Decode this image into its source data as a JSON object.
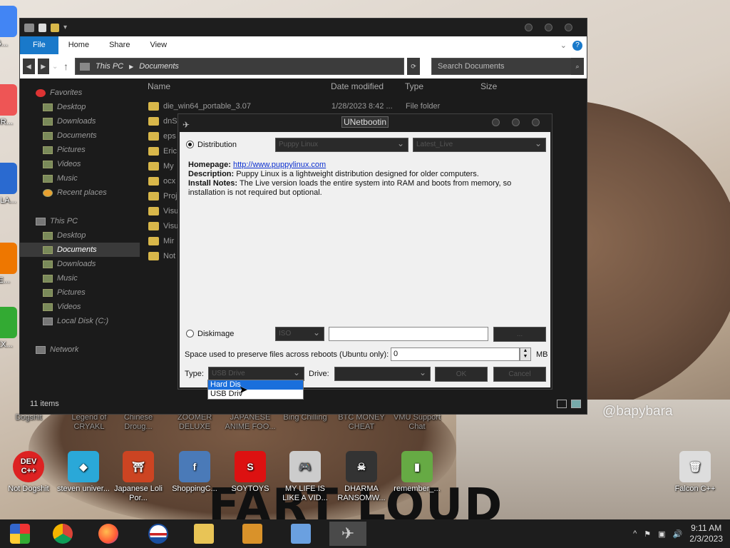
{
  "desktop": {
    "watermark": "@bapybara",
    "caption": "FART LOUD",
    "row_icons": [
      {
        "label": "Dogshit",
        "color": "#c33"
      },
      {
        "label": "Legend of CRYAKL",
        "color": "#555"
      },
      {
        "label": "Chinese Droug...",
        "color": "#8a4"
      },
      {
        "label": "ZOOMER DELUXE",
        "color": "#c63"
      },
      {
        "label": "JAPANESE ANIME FOO...",
        "color": "#a35"
      },
      {
        "label": "Bing Chilling",
        "color": "#58a"
      },
      {
        "label": "BTC MONEY CHEAT",
        "color": "#d90"
      },
      {
        "label": "VMU Support Chat",
        "color": "#469"
      }
    ],
    "bottom_icons": [
      {
        "label": "Not Dogshit",
        "color": "#d22",
        "glyph": "DEV C++"
      },
      {
        "label": "steven univer...",
        "color": "#2aa8d8",
        "glyph": "◆"
      },
      {
        "label": "Japanese Loli Por...",
        "color": "#c42",
        "glyph": "⛩"
      },
      {
        "label": "ShoppingC...",
        "color": "#4a7ab8",
        "glyph": "f"
      },
      {
        "label": "SOYTOYS",
        "color": "#d11",
        "glyph": "S"
      },
      {
        "label": "MY LIFE IS LIKE A VID...",
        "color": "#ccc",
        "glyph": "🎮"
      },
      {
        "label": "DHARMA RANSOMW...",
        "color": "#333",
        "glyph": "☠"
      },
      {
        "label": "remember_...",
        "color": "#6a4",
        "glyph": "▮"
      },
      {
        "label": "Falcon C++",
        "color": "#ddd",
        "glyph": "🗑"
      }
    ],
    "left_icons": [
      {
        "label": "G..."
      },
      {
        "label": "FUR..."
      },
      {
        "label": "OS LA..."
      },
      {
        "label": "BE..."
      },
      {
        "label": "SEX..."
      }
    ]
  },
  "explorer": {
    "ribbon_tabs": [
      "File",
      "Home",
      "Share",
      "View"
    ],
    "address": [
      "This PC",
      "Documents"
    ],
    "search_placeholder": "Search Documents",
    "nav": [
      {
        "label": "Favorites",
        "type": "hdr",
        "icon": "heart-icon"
      },
      {
        "label": "Desktop",
        "type": "item",
        "icon": "folder-icon"
      },
      {
        "label": "Downloads",
        "type": "item",
        "icon": "folder-icon"
      },
      {
        "label": "Documents",
        "type": "item",
        "icon": "folder-icon"
      },
      {
        "label": "Pictures",
        "type": "item",
        "icon": "folder-icon"
      },
      {
        "label": "Videos",
        "type": "item",
        "icon": "folder-icon"
      },
      {
        "label": "Music",
        "type": "item",
        "icon": "folder-icon"
      },
      {
        "label": "Recent places",
        "type": "item",
        "icon": "clock-icon"
      },
      {
        "label": "",
        "type": "spacer"
      },
      {
        "label": "This PC",
        "type": "hdr",
        "icon": "computer-icon"
      },
      {
        "label": "Desktop",
        "type": "item",
        "icon": "folder-icon"
      },
      {
        "label": "Documents",
        "type": "sel",
        "icon": "folder-icon"
      },
      {
        "label": "Downloads",
        "type": "item",
        "icon": "folder-icon"
      },
      {
        "label": "Music",
        "type": "item",
        "icon": "folder-icon"
      },
      {
        "label": "Pictures",
        "type": "item",
        "icon": "folder-icon"
      },
      {
        "label": "Videos",
        "type": "item",
        "icon": "folder-icon"
      },
      {
        "label": "Local Disk (C:)",
        "type": "item",
        "icon": "drive-icon"
      },
      {
        "label": "",
        "type": "spacer"
      },
      {
        "label": "Network",
        "type": "hdr",
        "icon": "network-icon"
      }
    ],
    "columns": [
      "Name",
      "Date modified",
      "Type",
      "Size"
    ],
    "files": [
      {
        "name": "die_win64_portable_3.07",
        "date": "1/28/2023 8:42 ...",
        "type": "File folder"
      },
      {
        "name": "dnS",
        "date": "",
        "type": ""
      },
      {
        "name": "eps",
        "date": "",
        "type": ""
      },
      {
        "name": "Eric",
        "date": "",
        "type": ""
      },
      {
        "name": "My",
        "date": "",
        "type": ""
      },
      {
        "name": "ocx",
        "date": "",
        "type": ""
      },
      {
        "name": "Proj",
        "date": "",
        "type": ""
      },
      {
        "name": "Visu",
        "date": "",
        "type": ""
      },
      {
        "name": "Visu",
        "date": "",
        "type": ""
      },
      {
        "name": "Mir",
        "date": "",
        "type": ""
      },
      {
        "name": "Not",
        "date": "",
        "type": ""
      }
    ],
    "status": "11 items"
  },
  "unetbootin": {
    "title": "UNetbootin",
    "distribution_label": "Distribution",
    "distribution_value": "Puppy Linux",
    "version_value": "Latest_Live",
    "homepage_label": "Homepage:",
    "homepage_url": "http://www.puppylinux.com",
    "description_label": "Description:",
    "description": "Puppy Linux is a lightweight distribution designed for older computers.",
    "install_label": "Install Notes:",
    "install_notes": "The Live version loads the entire system into RAM and boots from memory, so installation is not required but optional.",
    "diskimage_label": "Diskimage",
    "diskimage_type": "ISO",
    "diskimage_path": "",
    "browse_label": "...",
    "persist_label": "Space used to preserve files across reboots (Ubuntu only):",
    "persist_value": "0",
    "persist_unit": "MB",
    "type_label": "Type:",
    "type_value": "USB Drive",
    "drive_label": "Drive:",
    "drive_value": "",
    "ok_label": "OK",
    "cancel_label": "Cancel",
    "type_options": [
      "Hard Disk",
      "USB Drive"
    ],
    "type_options_display": [
      "Hard Dis",
      "USB Driv"
    ]
  },
  "taskbar": {
    "time": "9:11 AM",
    "date": "2/3/2023",
    "apps": [
      "start-button",
      "chrome-icon",
      "firefox-icon",
      "obama-icon",
      "file-explorer-icon",
      "book-icon",
      "notepad-icon",
      "unetbootin-icon"
    ]
  }
}
